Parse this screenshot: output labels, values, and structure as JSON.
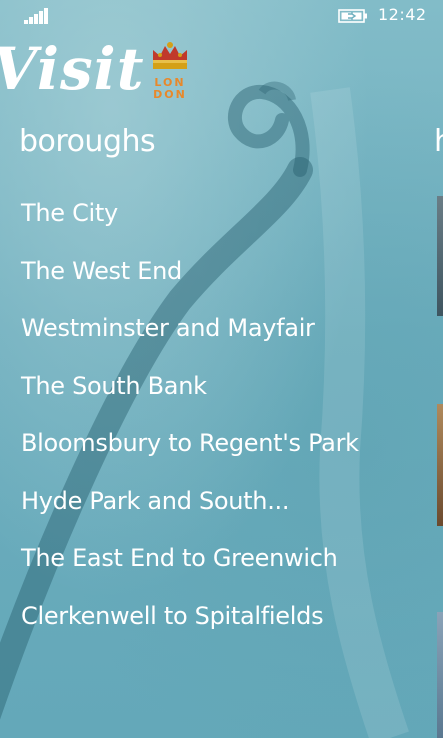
{
  "status": {
    "time": "12:42",
    "icons": [
      "signal-strength-icon",
      "battery-charging-icon"
    ]
  },
  "header": {
    "brand_word": "Visit",
    "badge_line1": "LON",
    "badge_line2": "DON",
    "badge_icon": "crown-icon"
  },
  "section": {
    "title": "boroughs",
    "next_title_peek": "h"
  },
  "boroughs": [
    "The City",
    "The West End",
    "Westminster and Mayfair",
    "The South Bank",
    "Bloomsbury to Regent's Park",
    "Hyde Park and South...",
    "The East End to Greenwich",
    "Clerkenwell to Spitalfields"
  ],
  "colors": {
    "background": "#6fb0bf",
    "text": "#ffffff",
    "badge_orange": "#e8882a",
    "crown_red": "#c0392b"
  }
}
